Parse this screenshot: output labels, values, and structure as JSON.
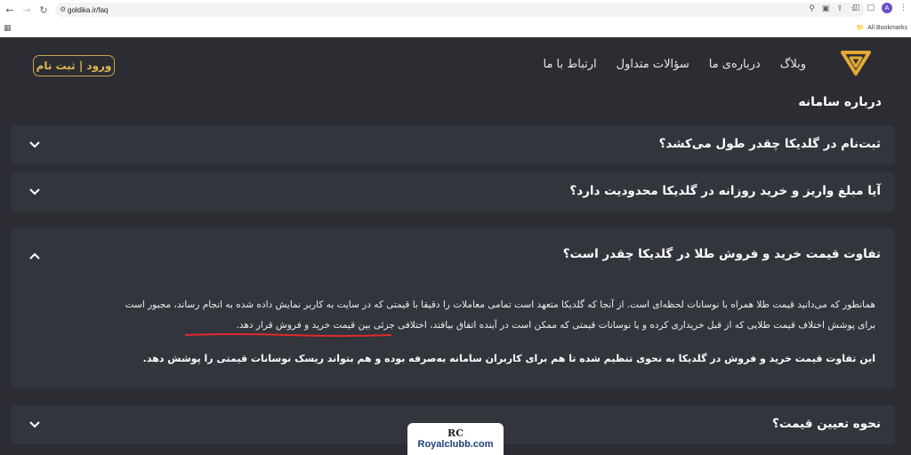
{
  "browser": {
    "url": "goldika.ir/faq",
    "profile_initial": "A",
    "bookmarks_label": "All Bookmarks"
  },
  "header": {
    "nav": [
      "وبلاگ",
      "درباره‌ی ما",
      "سؤالات متداول",
      "ارتباط با ما"
    ],
    "login_label": "ورود | ثبت نام",
    "accent_color": "#e3b64d"
  },
  "section_title": "درباره سامانه",
  "faqs": [
    {
      "question": "ثبت‌نام در گلدیکا چقدر طول می‌کشد؟",
      "expanded": false
    },
    {
      "question": "آیا مبلغ واریز و خرید روزانه در گلدیکا محدودیت دارد؟",
      "expanded": false
    },
    {
      "question": "تفاوت قیمت خرید و فروش طلا در گلدیکا چقدر است؟",
      "expanded": true,
      "answer_line1": "همانطور که می‌دانید قیمت طلا همراه با نوسانات لحظه‌ای است. از آنجا که گلدیکا متعهد است تمامی معاملات را دقیقا با قیمتی که در سایت به کاربر نمایش داده شده به انجام رساند، مجبور است",
      "answer_line2": "برای پوشش اختلاف قیمت طلایی که از قبل خریداری کرده و یا نوسانات قیمتی که ممکن است در آینده اتفاق بیافتد، اختلافی جزئی بین قیمت خرید و فروش قرار دهد.",
      "answer_bold": "این تفاوت قیمت خرید و فروش در گلدیکا به نحوی تنظیم شده تا هم برای کاربران سامانه به‌صرفه بوده و هم بتواند ریسک نوسانات قیمتی را پوشش دهد."
    },
    {
      "question": "نحوه تعیین قیمت؟",
      "expanded": false
    }
  ],
  "watermark": {
    "logo": "RC",
    "text": "Royalclubb.com"
  }
}
